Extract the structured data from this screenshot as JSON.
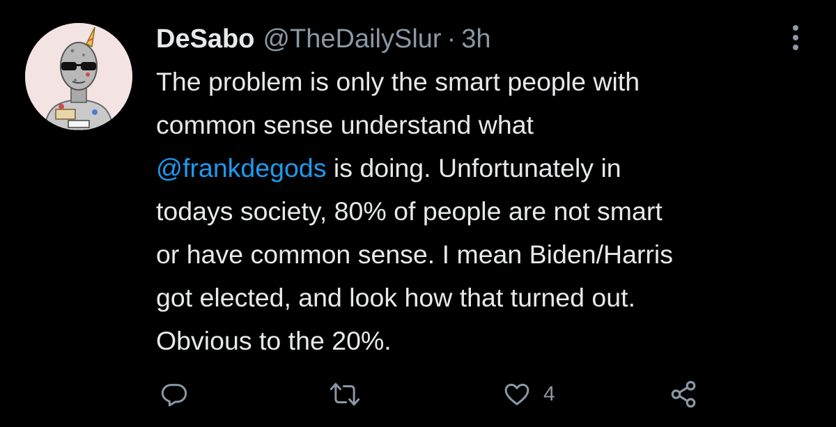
{
  "tweet": {
    "author": {
      "display_name": "DeSabo",
      "handle": "@TheDailySlur",
      "separator": "·",
      "time": "3h"
    },
    "lines": [
      {
        "text": "The problem is only the smart people with"
      },
      {
        "text": "common sense understand what"
      },
      {
        "mention": "@frankdegods",
        "text": " is doing.  Unfortunately in"
      },
      {
        "text": "todays society, 80% of people are not smart"
      },
      {
        "text": "or have common sense. I mean Biden/Harris"
      },
      {
        "text": "got elected, and look how that turned out."
      },
      {
        "text": "Obvious to the 20%."
      }
    ],
    "actions": {
      "reply": {
        "icon": "reply-icon"
      },
      "retweet": {
        "icon": "retweet-icon"
      },
      "like": {
        "icon": "heart-icon",
        "count": "4"
      },
      "share": {
        "icon": "share-icon"
      }
    }
  },
  "colors": {
    "background": "#000000",
    "text": "#e7e9ea",
    "secondary": "#8b98a5",
    "mention": "#1d9bf0"
  }
}
